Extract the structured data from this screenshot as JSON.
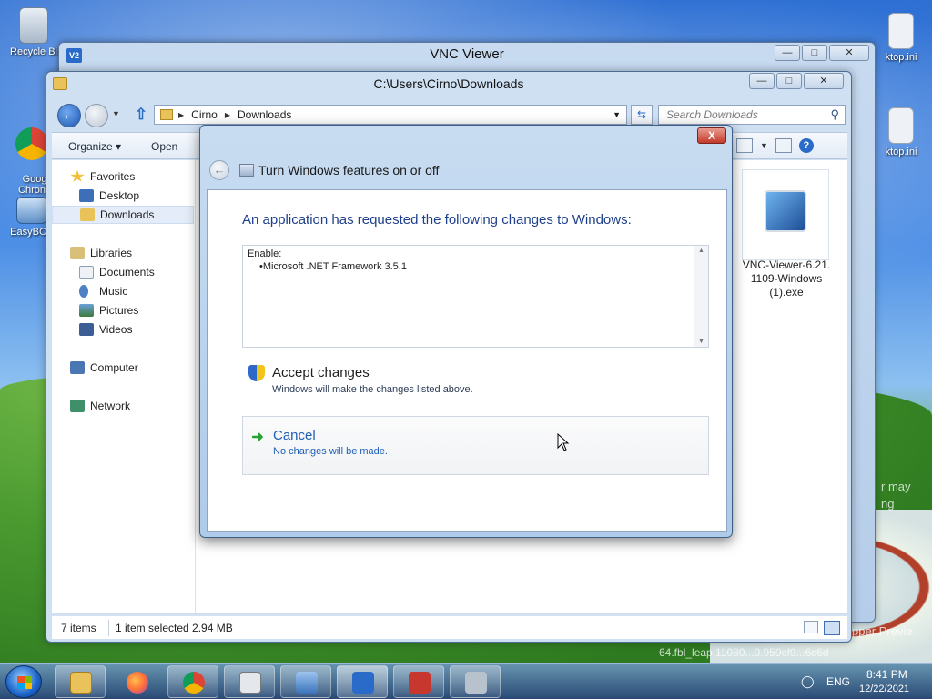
{
  "desktop": {
    "icons": [
      {
        "label": "Recycle Bi"
      },
      {
        "label": "Goog\nChron"
      },
      {
        "label": "EasyBCD"
      },
      {
        "label": "ktop.ini"
      },
      {
        "label": "ktop.ini"
      }
    ],
    "watermark": {
      "line1": "r may",
      "line2": "ng",
      "preview": "pper Previe",
      "build": "64.fbl_leap.11080...0.959cf9...6c6d"
    }
  },
  "vnc_window": {
    "title": "VNC Viewer",
    "logo": "V2"
  },
  "explorer": {
    "title": "C:\\Users\\Cirno\\Downloads",
    "breadcrumb": [
      "Cirno",
      "Downloads"
    ],
    "search_placeholder": "Search Downloads",
    "toolbar": {
      "organize": "Organize",
      "open": "Open"
    },
    "nav": {
      "favorites": "Favorites",
      "desktop": "Desktop",
      "downloads": "Downloads",
      "libraries": "Libraries",
      "documents": "Documents",
      "music": "Music",
      "pictures": "Pictures",
      "videos": "Videos",
      "computer": "Computer",
      "network": "Network"
    },
    "file": {
      "name": "VNC-Viewer-6.21.\n1109-Windows\n(1).exe"
    },
    "status": {
      "items": "7 items",
      "selected": "1 item selected  2.94 MB"
    }
  },
  "dialog": {
    "title": "Turn Windows features on or off",
    "heading": "An application has requested the following changes to Windows:",
    "changes": {
      "label": "Enable:",
      "items": [
        "Microsoft .NET Framework 3.5.1"
      ]
    },
    "accept": {
      "title": "Accept changes",
      "subtitle": "Windows will make the changes listed above."
    },
    "cancel": {
      "title": "Cancel",
      "subtitle": "No changes will be made."
    },
    "close": "X"
  },
  "taskbar": {
    "clock_time": "8:41 PM",
    "clock_date": "12/22/2021",
    "language": "ENG",
    "buttons": [
      "Explorer",
      "Firefox",
      "Chrome",
      "Media",
      "Control Panel",
      "VNC Viewer",
      "Toolbox",
      "Setup"
    ]
  },
  "colors": {
    "dialog_heading": "#1e3f8b",
    "link_blue": "#1e5fb5",
    "accent": "#2a6ac9"
  }
}
